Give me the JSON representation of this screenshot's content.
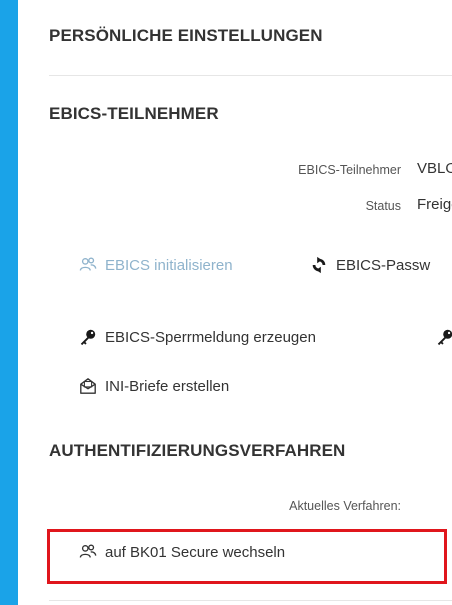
{
  "colors": {
    "background": "#1aa3e8",
    "highlight": "#e0161c",
    "disabled_text": "#8fb3cc"
  },
  "headings": {
    "personal": "PERSÖNLICHE EINSTELLUNGEN",
    "ebics": "EBICS-TEILNEHMER",
    "auth": "AUTHENTIFIZIERUNGSVERFAHREN"
  },
  "ebics": {
    "participant_label": "EBICS-Teilnehmer",
    "participant_value": "VBLO",
    "status_label": "Status",
    "status_value": "Freige"
  },
  "actions": {
    "initialize": {
      "label": "EBICS initialisieren",
      "icon": "users-icon"
    },
    "password": {
      "label": "EBICS-Passw",
      "icon": "refresh-icon"
    },
    "block_notice": {
      "label": "EBICS-Sperrmeldung erzeugen",
      "icon": "key-icon"
    },
    "ini_letters": {
      "label": "INI-Briefe erstellen",
      "icon": "envelope-icon"
    }
  },
  "auth": {
    "current_label": "Aktuelles Verfahren:",
    "switch_label": "auf BK01 Secure wechseln",
    "switch_icon": "users-icon"
  }
}
